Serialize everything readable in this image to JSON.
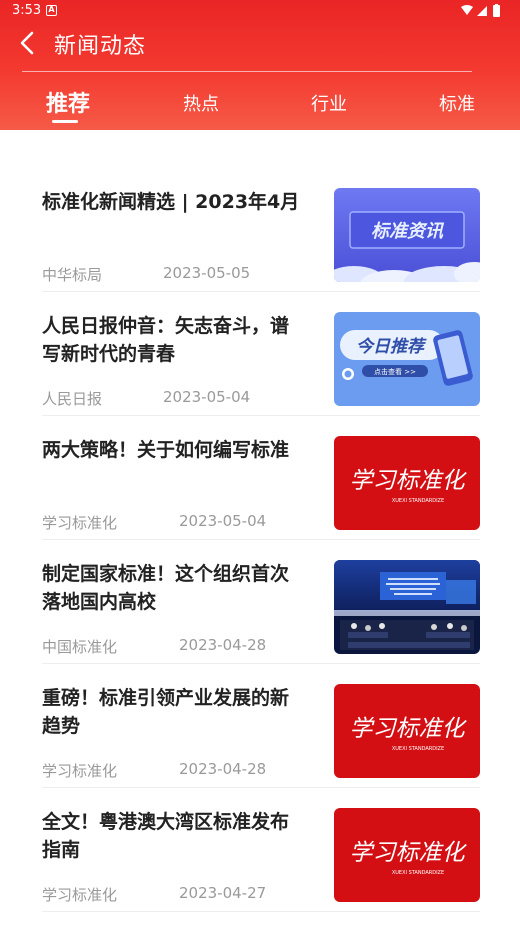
{
  "status_bar": {
    "time": "3:53",
    "notification_letter": "A"
  },
  "header": {
    "title": "新闻动态"
  },
  "tabs": [
    {
      "label": "推荐",
      "active": true
    },
    {
      "label": "热点",
      "active": false
    },
    {
      "label": "行业",
      "active": false
    },
    {
      "label": "标准",
      "active": false
    }
  ],
  "news": [
    {
      "title": "标准化新闻精选 | 2023年4月",
      "source": "中华标局",
      "date": "2023-05-05",
      "thumb_text": "标准资讯",
      "thumb_kind": "blue-banner"
    },
    {
      "title": "人民日报仲音：矢志奋斗，谱写新时代的青春",
      "source": "人民日报",
      "date": "2023-05-04",
      "thumb_text": "今日推荐",
      "thumb_sub": "点击查看 >>",
      "thumb_kind": "phone-banner"
    },
    {
      "title": "两大策略！关于如何编写标准",
      "source": "学习标准化",
      "date": "2023-05-04",
      "thumb_text": "学习标准化",
      "thumb_sub": "XUEXI STANDARDIZE",
      "thumb_kind": "red-logo"
    },
    {
      "title": "制定国家标准！这个组织首次落地国内高校",
      "source": "中国标准化",
      "date": "2023-04-28",
      "thumb_kind": "conference-photo"
    },
    {
      "title": "重磅！标准引领产业发展的新趋势",
      "source": "学习标准化",
      "date": "2023-04-28",
      "thumb_text": "学习标准化",
      "thumb_sub": "XUEXI STANDARDIZE",
      "thumb_kind": "red-logo"
    },
    {
      "title": "全文！粤港澳大湾区标准发布指南",
      "source": "学习标准化",
      "date": "2023-04-27",
      "thumb_text": "学习标准化",
      "thumb_sub": "XUEXI STANDARDIZE",
      "thumb_kind": "red-logo"
    }
  ],
  "colors": {
    "header_red": "#ea2525",
    "header_light": "#f65a48",
    "logo_red": "#d40f14",
    "banner_blue": "#5a63e8"
  }
}
